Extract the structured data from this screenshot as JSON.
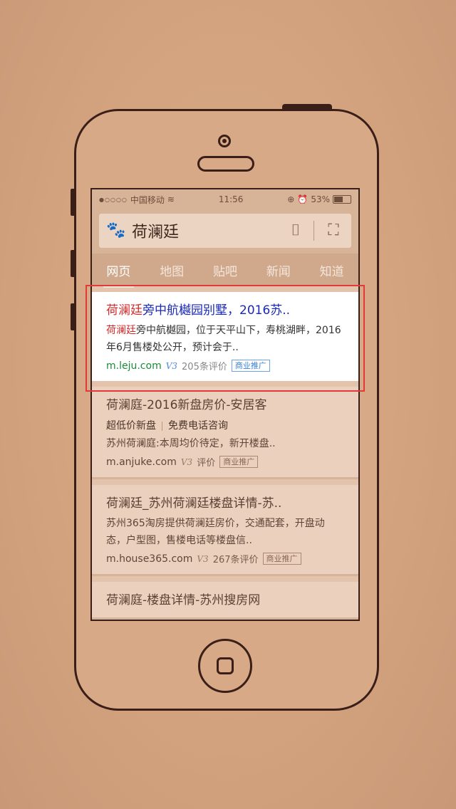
{
  "status_bar": {
    "carrier": "中国移动",
    "time": "11:56",
    "battery": "53%",
    "battery_level": 0.53
  },
  "search": {
    "query": "荷澜廷",
    "logo_icon": "baidu-paw-icon",
    "camera_icon": "camera-icon",
    "scan_icon": "scan-icon"
  },
  "tabs": [
    {
      "label": "网页",
      "active": true
    },
    {
      "label": "地图"
    },
    {
      "label": "贴吧"
    },
    {
      "label": "新闻"
    },
    {
      "label": "知道"
    }
  ],
  "results": [
    {
      "title_hl": "荷澜廷",
      "title_rest": "旁中航樾园别墅，2016苏..",
      "desc_hl": "荷澜廷",
      "desc_rest": "旁中航樾园，位于天平山下，寿桃湖畔，2016年6月售楼处公开，预计会于..",
      "url": "m.leju.com",
      "v3": "V3",
      "reviews": "205条评价",
      "ad": "商业推广"
    },
    {
      "title": "荷澜庭-2016新盘房价-安居客",
      "chip1": "超低价新盘",
      "chip2": "免费电话咨询",
      "desc": "苏州荷澜庭:本周均价待定，新开楼盘..",
      "url": "m.anjuke.com",
      "v3": "V3",
      "reviews": "评价",
      "ad": "商业推广"
    },
    {
      "title": "荷澜廷_苏州荷澜廷楼盘详情-苏..",
      "desc": "苏州365淘房提供荷澜廷房价，交通配套，开盘动态，户型图，售楼电话等楼盘信..",
      "url": "m.house365.com",
      "v3": "V3",
      "reviews": "267条评价",
      "ad": "商业推广"
    },
    {
      "title": "荷澜庭-楼盘详情-苏州搜房网"
    }
  ]
}
